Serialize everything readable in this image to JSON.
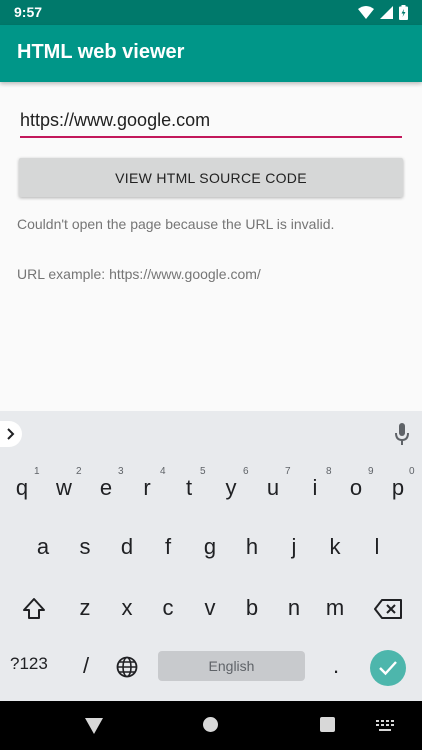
{
  "status_bar": {
    "time": "9:57"
  },
  "app_bar": {
    "title": "HTML web viewer"
  },
  "form": {
    "url_value": "https://www.google.com",
    "button_label": "VIEW HTML SOURCE CODE",
    "error_message": "Couldn't open the page because the URL is invalid.",
    "example_message": "URL example: https://www.google.com/"
  },
  "keyboard": {
    "row1": [
      "q",
      "w",
      "e",
      "r",
      "t",
      "y",
      "u",
      "i",
      "o",
      "p"
    ],
    "row1_hints": [
      "1",
      "2",
      "3",
      "4",
      "5",
      "6",
      "7",
      "8",
      "9",
      "0"
    ],
    "row2": [
      "a",
      "s",
      "d",
      "f",
      "g",
      "h",
      "j",
      "k",
      "l"
    ],
    "row3": [
      "z",
      "x",
      "c",
      "v",
      "b",
      "n",
      "m"
    ],
    "symbols_label": "?123",
    "slash_label": "/",
    "space_label": "English",
    "period_label": "."
  },
  "accent_color": "#009688",
  "status_bar_color": "#00796b",
  "underline_color": "#c2185b"
}
